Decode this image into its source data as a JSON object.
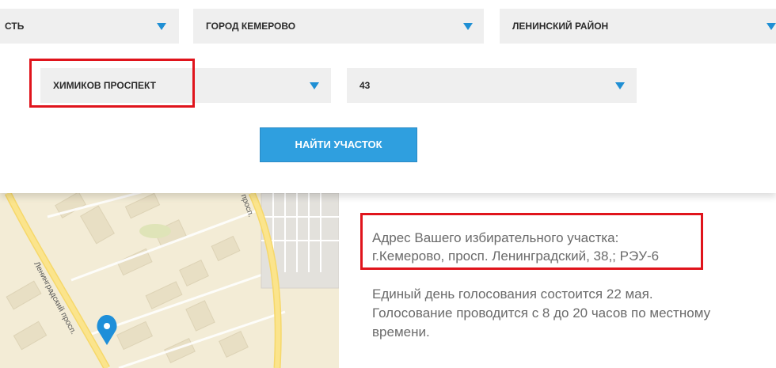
{
  "search": {
    "region": {
      "value": "СТЬ"
    },
    "city": {
      "value": "ГОРОД КЕМЕРОВО"
    },
    "district": {
      "value": "ЛЕНИНСКИЙ РАЙОН"
    },
    "street": {
      "value": "ХИМИКОВ ПРОСПЕКТ"
    },
    "house": {
      "value": "43"
    },
    "find_button": "НАЙТИ УЧАСТОК"
  },
  "map": {
    "street_labels": [
      "Ленинградский просп.",
      "просп."
    ],
    "marker_icon": "map-pin-icon"
  },
  "result": {
    "address_line1": "Адрес Вашего избирательного участка:",
    "address_line2": "г.Кемерово, просп. Ленинградский, 38,; РЭУ-6",
    "vote_line1": "Единый день голосования состоится 22 мая.",
    "vote_line2": "Голосование проводится с 8 до 20 часов по местному",
    "vote_line3": "времени."
  },
  "colors": {
    "accent": "#2f9fdf",
    "caret": "#1f8fd4",
    "highlight": "#e0141c",
    "select_bg": "#efefef",
    "map_bg": "#f3ecd6"
  }
}
